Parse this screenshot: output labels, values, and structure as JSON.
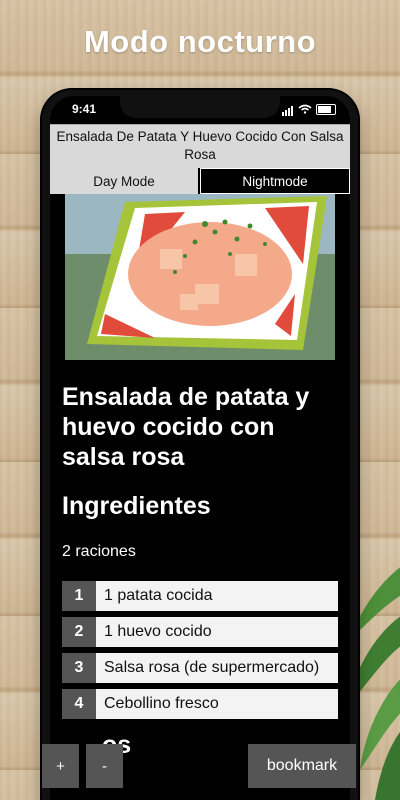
{
  "headline": "Modo nocturno",
  "status": {
    "time": "9:41"
  },
  "app": {
    "title": "Ensalada De Patata Y Huevo Cocido Con Salsa Rosa",
    "modes": {
      "day": "Day Mode",
      "night": "Nightmode"
    }
  },
  "recipe": {
    "heading": "Ensalada de patata y huevo cocido con salsa rosa",
    "ingredients_heading": "Ingredientes",
    "servings": "2 raciones",
    "ingredients": [
      {
        "num": "1",
        "text": "1 patata cocida"
      },
      {
        "num": "2",
        "text": "1 huevo cocido"
      },
      {
        "num": "3",
        "text": "Salsa rosa (de supermercado)"
      },
      {
        "num": "4",
        "text": "Cebollino fresco"
      }
    ],
    "next_heading_partial": "os"
  },
  "controls": {
    "plus": "+",
    "minus": "-",
    "bookmark": "bookmark"
  },
  "colors": {
    "accent_gray": "#555555",
    "title_bar": "#d9d9d9"
  }
}
